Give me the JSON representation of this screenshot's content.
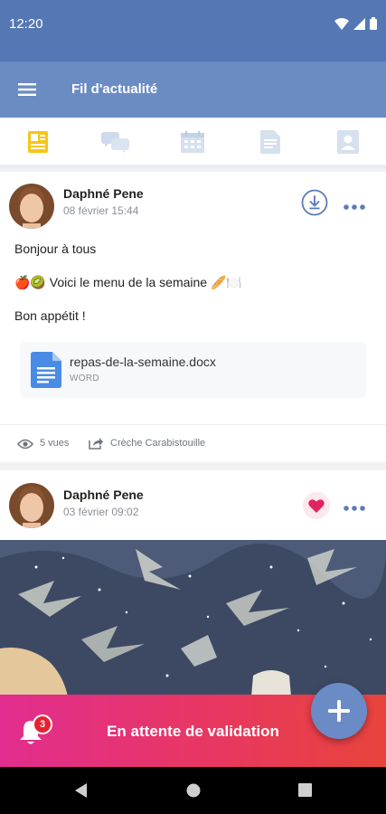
{
  "status_bar": {
    "time": "12:20"
  },
  "app_bar": {
    "title": "Fil d'actualité"
  },
  "tabs": [
    {
      "icon": "newsfeed-icon",
      "active": true
    },
    {
      "icon": "chat-bubbles-icon",
      "active": false
    },
    {
      "icon": "calendar-icon",
      "active": false
    },
    {
      "icon": "document-icon",
      "active": false
    },
    {
      "icon": "profile-card-icon",
      "active": false
    }
  ],
  "posts": [
    {
      "author": "Daphné Pene",
      "date": "08 février 15:44",
      "lines": [
        "Bonjour à tous",
        "🍎🥝 Voici le menu de la semaine 🥖🍽️",
        "Bon appétit !"
      ],
      "attachment": {
        "name": "repas-de-la-semaine.docx",
        "type": "WORD"
      },
      "views": "5 vues",
      "shared_to": "Crèche Carabistouille"
    },
    {
      "author": "Daphné Pene",
      "date": "03 février 09:02",
      "liked": true
    }
  ],
  "banner": {
    "text": "En attente de validation",
    "badge_count": "3"
  },
  "colors": {
    "status_bar": "#5577b4",
    "app_bar": "#6b8cc3",
    "accent": "#6a8bc5",
    "banner_start": "#e22d8f",
    "banner_end": "#e8443b",
    "active_tab": "#f5c518"
  }
}
